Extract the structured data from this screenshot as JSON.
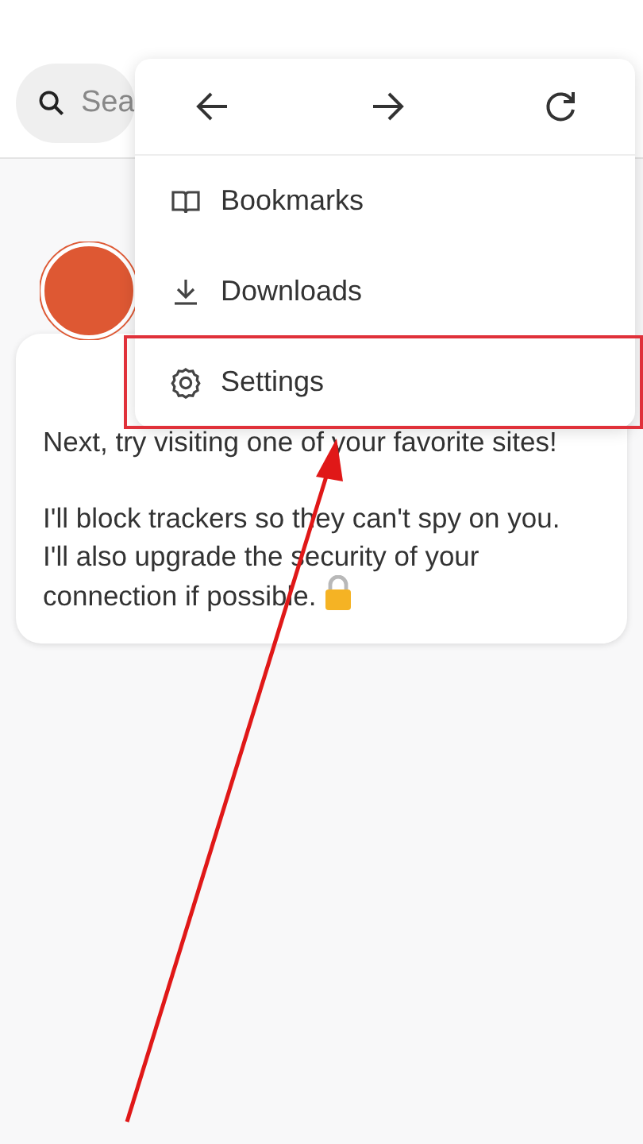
{
  "search": {
    "placeholder": "Sea"
  },
  "menu": {
    "nav_buttons": [
      {
        "kind": "back"
      },
      {
        "kind": "forward"
      },
      {
        "kind": "refresh"
      }
    ],
    "items": [
      {
        "kind": "bookmarks",
        "label": "Bookmarks",
        "highlighted": false
      },
      {
        "kind": "downloads",
        "label": "Downloads",
        "highlighted": false
      },
      {
        "kind": "settings",
        "label": "Settings",
        "highlighted": true
      }
    ]
  },
  "message": {
    "paragraphs": [
      "Next, try visiting one of your favorite sites!",
      "I'll block trackers so they can't spy on you. I'll also upgrade the security of your connection if possible."
    ],
    "lock": true
  }
}
